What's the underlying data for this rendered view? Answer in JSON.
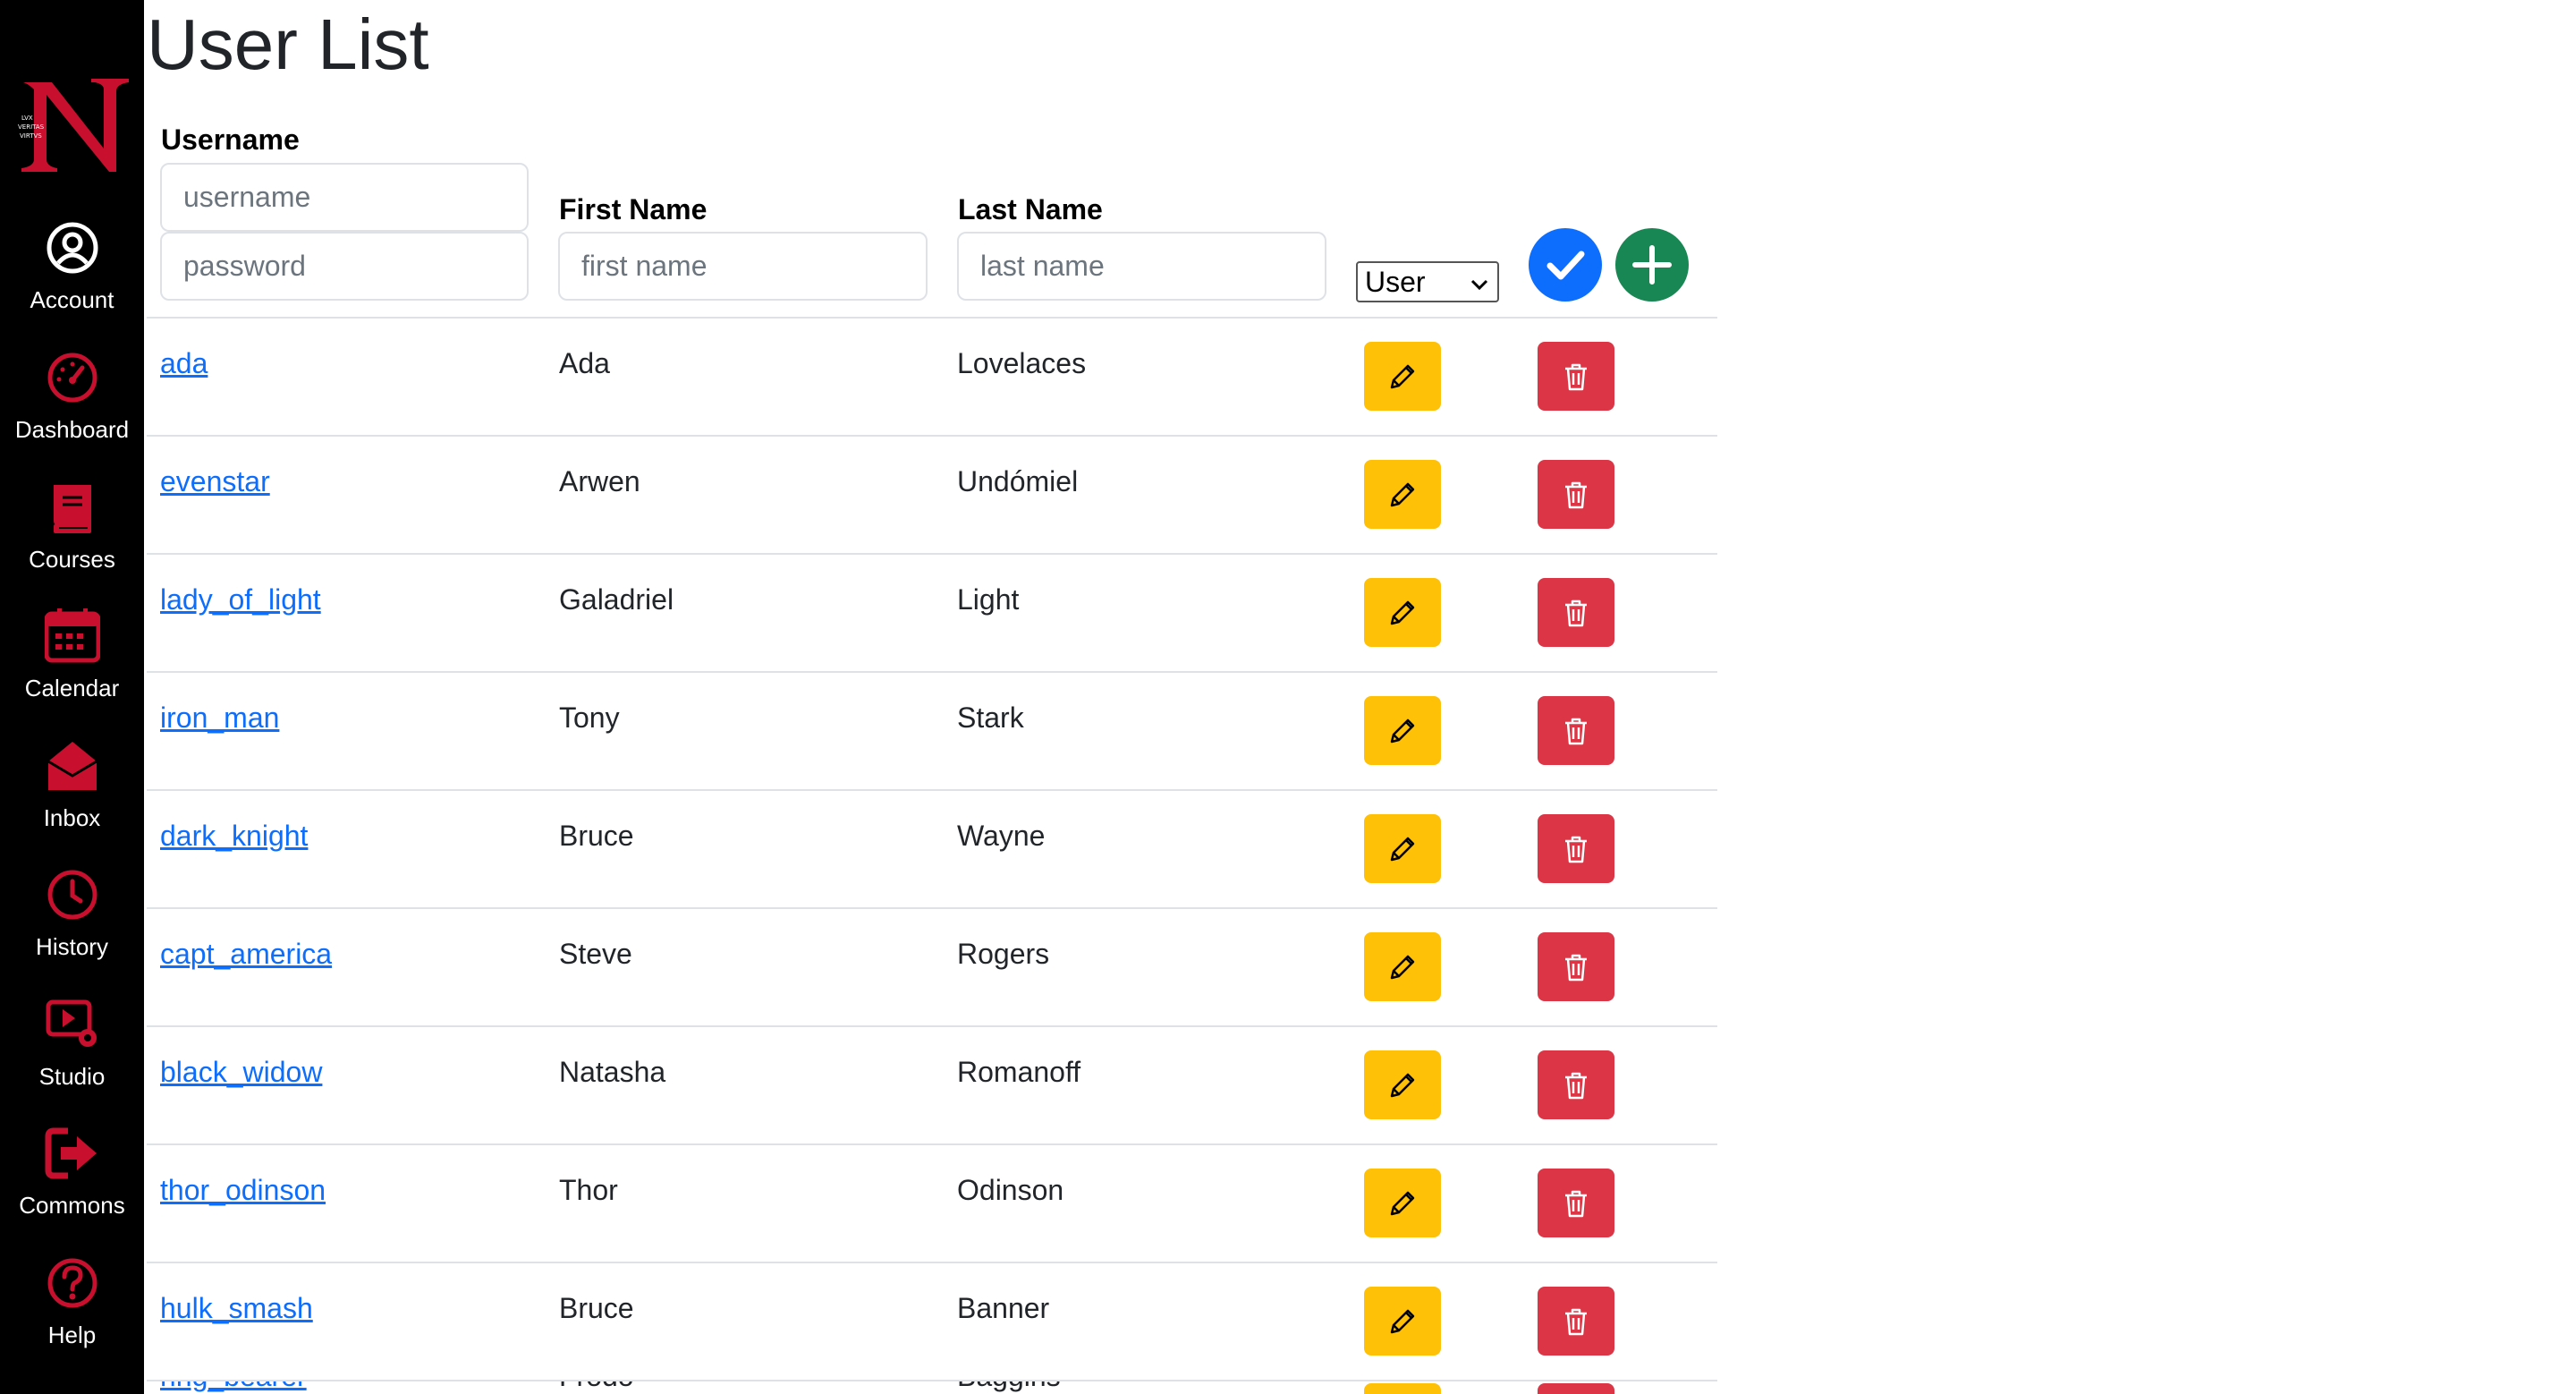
{
  "page": {
    "title": "User List"
  },
  "sidebar": {
    "items": [
      {
        "label": "Account",
        "icon": "account-circle-icon"
      },
      {
        "label": "Dashboard",
        "icon": "speedometer-icon"
      },
      {
        "label": "Courses",
        "icon": "book-icon"
      },
      {
        "label": "Calendar",
        "icon": "calendar-icon"
      },
      {
        "label": "Inbox",
        "icon": "envelope-open-icon"
      },
      {
        "label": "History",
        "icon": "clock-icon"
      },
      {
        "label": "Studio",
        "icon": "video-settings-icon"
      },
      {
        "label": "Commons",
        "icon": "exit-arrow-icon"
      },
      {
        "label": "Help",
        "icon": "question-circle-icon"
      }
    ],
    "logo": {
      "letter": "N",
      "motto": [
        "LVX",
        "VERITAS",
        "VIRTVS"
      ]
    }
  },
  "form": {
    "username_label": "Username",
    "username_placeholder": "username",
    "password_placeholder": "password",
    "first_name_label": "First Name",
    "first_name_placeholder": "first name",
    "last_name_label": "Last Name",
    "last_name_placeholder": "last name",
    "role_value": "User",
    "save_icon": "checkmark-icon",
    "add_icon": "plus-icon"
  },
  "users": [
    {
      "username": "ada",
      "first": "Ada",
      "last": "Lovelaces"
    },
    {
      "username": "evenstar",
      "first": "Arwen",
      "last": "Undómiel"
    },
    {
      "username": "lady_of_light",
      "first": "Galadriel",
      "last": "Light"
    },
    {
      "username": "iron_man",
      "first": "Tony",
      "last": "Stark"
    },
    {
      "username": "dark_knight",
      "first": "Bruce",
      "last": "Wayne"
    },
    {
      "username": "capt_america",
      "first": "Steve",
      "last": "Rogers"
    },
    {
      "username": "black_widow",
      "first": "Natasha",
      "last": "Romanoff"
    },
    {
      "username": "thor_odinson",
      "first": "Thor",
      "last": "Odinson"
    },
    {
      "username": "hulk_smash",
      "first": "Bruce",
      "last": "Banner"
    },
    {
      "username": "ring_bearer",
      "first": "Frodo",
      "last": "Baggins"
    }
  ],
  "colors": {
    "sidebar_bg": "#000000",
    "accent_red": "#c8102e",
    "link": "#0d6efd",
    "edit": "#ffc107",
    "delete": "#dc3545",
    "save": "#0d6efd",
    "add": "#198754"
  }
}
